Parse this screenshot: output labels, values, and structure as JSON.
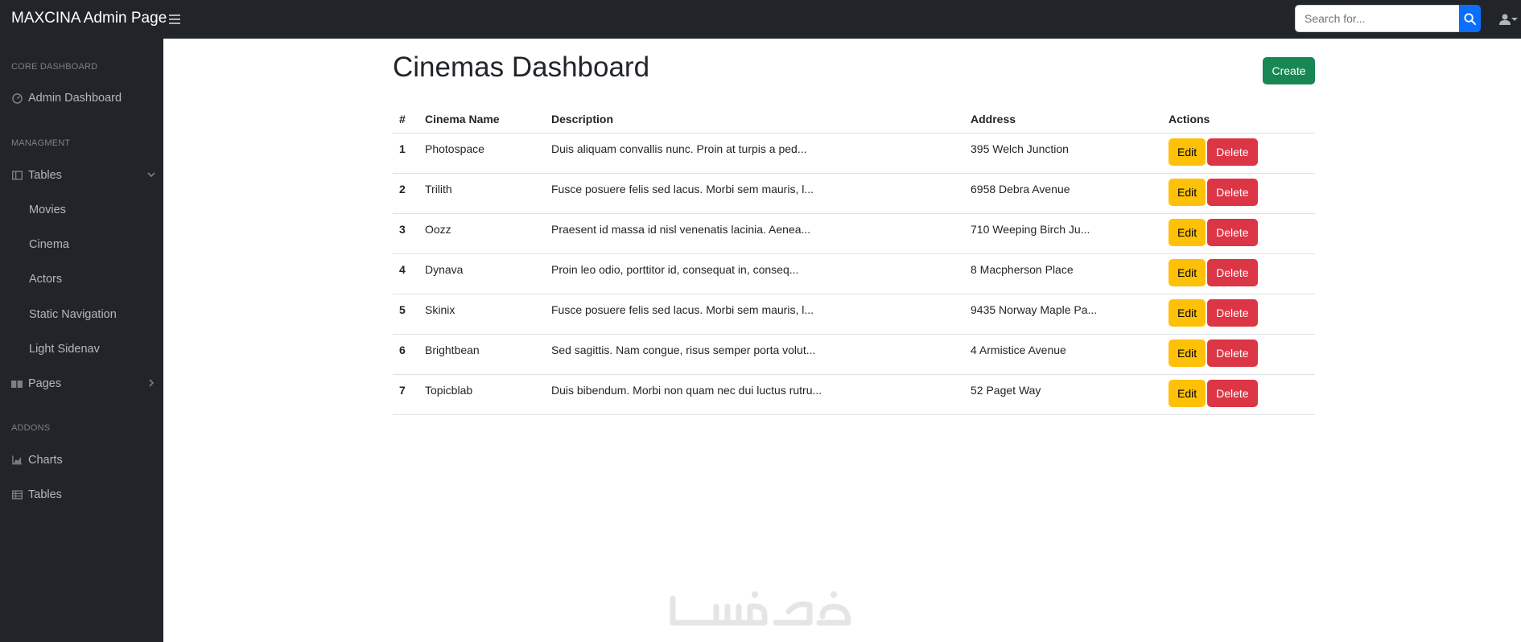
{
  "navbar": {
    "brand": "MAXCINA Admin Page",
    "search_placeholder": "Search for...",
    "search_value": ""
  },
  "sidebar": {
    "core_heading": "CORE DASHBOARD",
    "admin_dashboard": "Admin Dashboard",
    "management_heading": "MANAGMENT",
    "tables": "Tables",
    "tables_items": [
      "Movies",
      "Cinema",
      "Actors",
      "Static Navigation",
      "Light Sidenav"
    ],
    "pages": "Pages",
    "addons_heading": "ADDONS",
    "charts": "Charts",
    "addon_tables": "Tables"
  },
  "main": {
    "title": "Cinemas Dashboard",
    "create_label": "Create",
    "columns": [
      "#",
      "Cinema Name",
      "Description",
      "Address",
      "Actions"
    ],
    "edit_label": "Edit",
    "delete_label": "Delete",
    "rows": [
      {
        "num": "1",
        "name": "Photospace",
        "description": "Duis aliquam convallis nunc. Proin at turpis a ped...",
        "address": "395 Welch Junction"
      },
      {
        "num": "2",
        "name": "Trilith",
        "description": "Fusce posuere felis sed lacus. Morbi sem mauris, l...",
        "address": "6958 Debra Avenue"
      },
      {
        "num": "3",
        "name": "Oozz",
        "description": "Praesent id massa id nisl venenatis lacinia. Aenea...",
        "address": "710 Weeping Birch Ju..."
      },
      {
        "num": "4",
        "name": "Dynava",
        "description": "Proin leo odio, porttitor id, consequat in, conseq...",
        "address": "8 Macpherson Place"
      },
      {
        "num": "5",
        "name": "Skinix",
        "description": "Fusce posuere felis sed lacus. Morbi sem mauris, l...",
        "address": "9435 Norway Maple Pa..."
      },
      {
        "num": "6",
        "name": "Brightbean",
        "description": "Sed sagittis. Nam congue, risus semper porta volut...",
        "address": "4 Armistice Avenue"
      },
      {
        "num": "7",
        "name": "Topicblab",
        "description": "Duis bibendum. Morbi non quam nec dui luctus rutru...",
        "address": "52 Paget Way"
      }
    ]
  },
  "watermark": {
    "text": "خمسات",
    "color": "#e5e5e5"
  },
  "colors": {
    "dark": "#212529",
    "primary": "#0d6efd",
    "success": "#198754",
    "warning": "#ffc107",
    "danger": "#dc3545"
  }
}
